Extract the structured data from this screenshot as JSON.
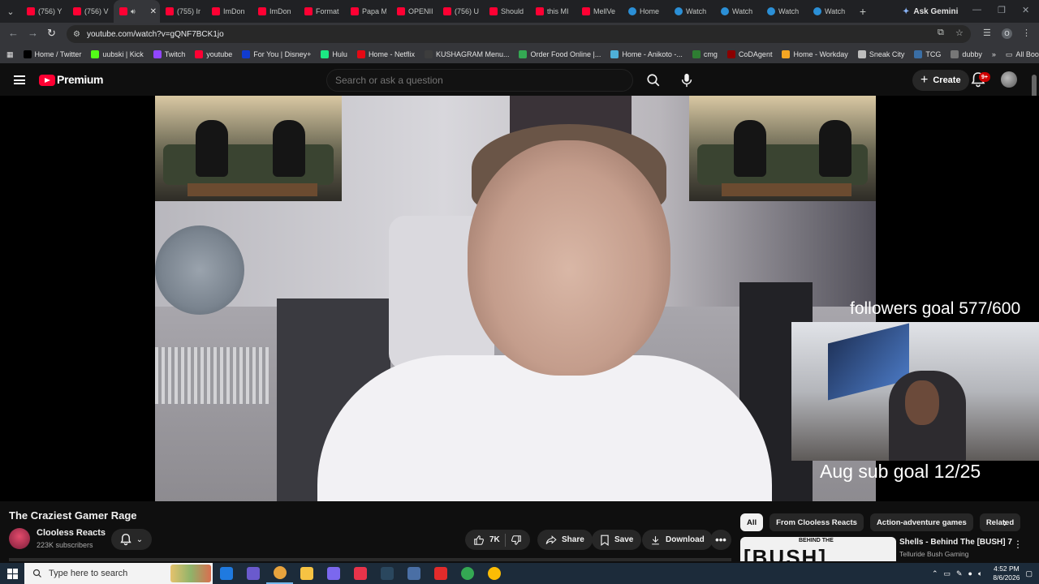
{
  "browser": {
    "tabs": [
      {
        "title": "(756) Y",
        "icon": "youtube-icon",
        "active": false
      },
      {
        "title": "(756) V",
        "icon": "youtube-icon",
        "active": false
      },
      {
        "title": "",
        "icon": "youtube-icon",
        "active": true,
        "audio": true
      },
      {
        "title": "(755) Ir",
        "icon": "youtube-icon",
        "active": false
      },
      {
        "title": "ImDon",
        "icon": "youtube-icon",
        "active": false
      },
      {
        "title": "ImDon",
        "icon": "youtube-icon",
        "active": false
      },
      {
        "title": "Format",
        "icon": "youtube-icon",
        "active": false
      },
      {
        "title": "Papa M",
        "icon": "youtube-icon",
        "active": false
      },
      {
        "title": "OPENII",
        "icon": "youtube-icon",
        "active": false
      },
      {
        "title": "(756) U",
        "icon": "youtube-icon",
        "active": false
      },
      {
        "title": "Should",
        "icon": "youtube-icon",
        "active": false
      },
      {
        "title": "this MI",
        "icon": "youtube-icon",
        "active": false
      },
      {
        "title": "MellVe",
        "icon": "youtube-icon",
        "active": false
      },
      {
        "title": "Home",
        "icon": "globe-icon",
        "active": false
      },
      {
        "title": "Watch",
        "icon": "globe-icon",
        "active": false
      },
      {
        "title": "Watch",
        "icon": "globe-icon",
        "active": false
      },
      {
        "title": "Watch",
        "icon": "globe-icon",
        "active": false
      },
      {
        "title": "Watch",
        "icon": "globe-icon",
        "active": false
      }
    ],
    "gemini_label": "Ask Gemini",
    "url": "youtube.com/watch?v=gQNF7BCK1jo",
    "profile_initial": "O",
    "bookmarks": [
      {
        "label": "Home / Twitter",
        "color": "#000000"
      },
      {
        "label": "uubski | Kick",
        "color": "#53fc18"
      },
      {
        "label": "Twitch",
        "color": "#9146ff"
      },
      {
        "label": "youtube",
        "color": "#ff0033"
      },
      {
        "label": "For You | Disney+",
        "color": "#113ccf"
      },
      {
        "label": "Hulu",
        "color": "#1ce783"
      },
      {
        "label": "Home - Netflix",
        "color": "#e50914"
      },
      {
        "label": "KUSHAGRAM Menu...",
        "color": "#3d3d3d"
      },
      {
        "label": "Order Food Online |...",
        "color": "#34a853"
      },
      {
        "label": "Home - Anikoto -...",
        "color": "#4fb0d8"
      },
      {
        "label": "cmg",
        "color": "#2e7d32"
      },
      {
        "label": "CoDAgent",
        "color": "#8b0000"
      },
      {
        "label": "Home - Workday",
        "color": "#f5a623"
      },
      {
        "label": "Sneak City",
        "color": "#bdbdbd"
      },
      {
        "label": "TCG",
        "color": "#3a6ea5"
      },
      {
        "label": "dubby",
        "color": "#777777"
      }
    ],
    "all_bookmarks_label": "All Bookmarks"
  },
  "youtube": {
    "logo_text": "Premium",
    "search_placeholder": "Search or ask a question",
    "create_label": "Create",
    "notification_badge": "9+",
    "overlay": {
      "followers_goal": "followers goal 577/600",
      "sub_goal": "Aug sub goal 12/25"
    },
    "video": {
      "title": "The Craziest Gamer Rage",
      "channel": "Clooless Reacts",
      "subscribers": "223K subscribers",
      "likes": "7K",
      "share_label": "Share",
      "save_label": "Save",
      "download_label": "Download"
    },
    "chips": [
      {
        "label": "All",
        "active": true
      },
      {
        "label": "From Clooless Reacts",
        "active": false
      },
      {
        "label": "Action-adventure games",
        "active": false
      },
      {
        "label": "Related",
        "active": false
      }
    ],
    "recommendation": {
      "thumb_big": "[BUSH]",
      "thumb_small": "BEHIND THE",
      "title": "Shells - Behind The [BUSH] 7",
      "channel": "Telluride Bush Gaming"
    }
  },
  "taskbar": {
    "search_placeholder": "Type here to search",
    "apps": [
      {
        "icon": "chat-icon",
        "color": "#1f7ae0"
      },
      {
        "icon": "chrome-profile-icon",
        "color": "#6a5acd"
      },
      {
        "icon": "chrome-icon",
        "color": "#e8a33d"
      },
      {
        "icon": "file-explorer-icon",
        "color": "#f6c343"
      },
      {
        "icon": "game-controller-icon",
        "color": "#7b68ee"
      },
      {
        "icon": "media-player-icon",
        "color": "#e8334a"
      },
      {
        "icon": "steam-icon",
        "color": "#2a475e"
      },
      {
        "icon": "app-icon",
        "color": "#4a6fa5"
      },
      {
        "icon": "adobe-icon",
        "color": "#e22b2b"
      },
      {
        "icon": "chrome-icon-2",
        "color": "#34a853"
      },
      {
        "icon": "chrome-icon-3",
        "color": "#fbbc05"
      }
    ],
    "time": "4:52 PM",
    "date": "8/6/2026"
  }
}
